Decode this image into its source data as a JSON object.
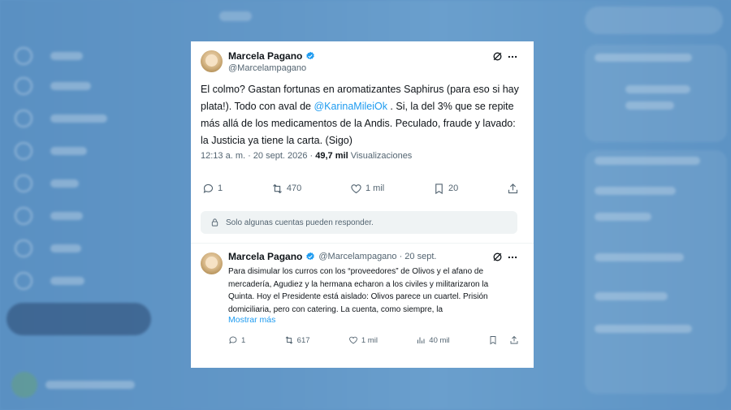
{
  "main_tweet": {
    "author_name": "Marcela Pagano",
    "author_handle": "@Marcelampagano",
    "text_part1": "El colmo? Gastan fortunas en aromatizantes Saphirus (para eso si hay plata!). Todo con aval de ",
    "mention": "@KarinaMileiOk",
    "text_part2": " . Si, la del 3% que se repite más allá de los medicamentos de la Andis. Peculado, fraude y lavado: la Justicia ya tiene la carta. (Sigo)",
    "timestamp": "12:13 a. m. · 20 sept. 2026 ·",
    "views_count": "49,7 mil",
    "views_label": "Visualizaciones",
    "replies": "1",
    "reposts": "470",
    "likes": "1 mil",
    "bookmarks": "20",
    "restriction_text": "Solo algunas cuentas pueden responder."
  },
  "reply_tweet": {
    "author_name": "Marcela Pagano",
    "author_handle_date": "@Marcelampagano · 20 sept.",
    "text": "Para disimular los curros con los “proveedores” de Olivos y el afano de mercadería, Agudiez y la hermana echaron a los civiles y militarizaron la Quinta. Hoy el Presidente está aislado: Olivos parece un cuartel. Prisión domiciliaria, pero con catering. La cuenta, como siempre, la",
    "show_more": "Mostrar más",
    "replies": "1",
    "reposts": "617",
    "likes": "1 mil",
    "views": "40 mil"
  },
  "colors": {
    "accent": "#1d9bf0",
    "background": "#5f95c6",
    "muted_text": "#536471"
  },
  "icons": [
    "verified-badge-icon",
    "grok-icon",
    "more-icon",
    "reply-icon",
    "repost-icon",
    "like-icon",
    "bookmark-icon",
    "share-icon",
    "lock-icon",
    "views-icon"
  ]
}
